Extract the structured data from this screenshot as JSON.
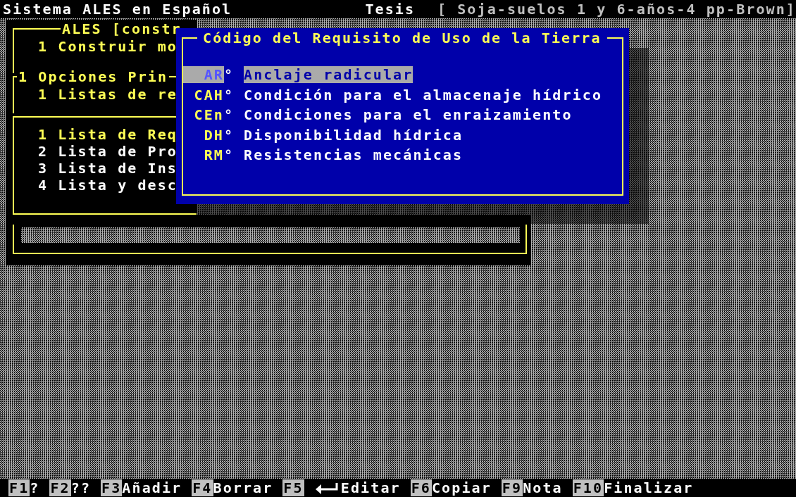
{
  "title_bar": {
    "app": "Sistema ALES en Español",
    "mode": "Tesis",
    "model": "[ Soja-suelos 1 y 6-años-4 pp-Brown]"
  },
  "menus": [
    {
      "title": "ALES [constr",
      "items": [
        {
          "number": "1",
          "label": "Construir mo",
          "selected": true
        }
      ]
    },
    {
      "title": "1 Opciones Prin",
      "items": [
        {
          "number": "1",
          "label": "Listas de re",
          "selected": true
        }
      ]
    },
    {
      "items": [
        {
          "number": "1",
          "label": "Lista de Req",
          "selected": true
        },
        {
          "number": "2",
          "label": "Lista de Pro",
          "selected": false
        },
        {
          "number": "3",
          "label": "Lista de Ins",
          "selected": false
        },
        {
          "number": "4",
          "label": "Lista y desc",
          "selected": false
        }
      ]
    }
  ],
  "dialog": {
    "title": "Código del Requisito de Uso de la Tierra",
    "items": [
      {
        "code": "AR",
        "mark": "°",
        "name": "Anclaje radicular",
        "selected": true
      },
      {
        "code": "CAH",
        "mark": "°",
        "name": "Condición para el almacenaje hídrico",
        "selected": false
      },
      {
        "code": "CEn",
        "mark": "°",
        "name": "Condiciones para el enraizamiento",
        "selected": false
      },
      {
        "code": "DH",
        "mark": "°",
        "name": "Disponibilidad hídrica",
        "selected": false
      },
      {
        "code": "RM",
        "mark": "°",
        "name": "Resistencias mecánicas",
        "selected": false
      }
    ]
  },
  "function_keys": [
    {
      "key": "F1",
      "label": "?",
      "kind": "text"
    },
    {
      "key": "F2",
      "label": "??",
      "kind": "text"
    },
    {
      "key": "F3",
      "label": "Añadir",
      "kind": "text"
    },
    {
      "key": "F4",
      "label": "Borrar",
      "kind": "text"
    },
    {
      "key": "F5",
      "label": "Editar",
      "kind": "enter"
    },
    {
      "key": "F6",
      "label": "Copiar",
      "kind": "text"
    },
    {
      "key": "F9",
      "label": "Nota",
      "kind": "text"
    },
    {
      "key": "F10",
      "label": "Finalizar",
      "kind": "text"
    }
  ]
}
